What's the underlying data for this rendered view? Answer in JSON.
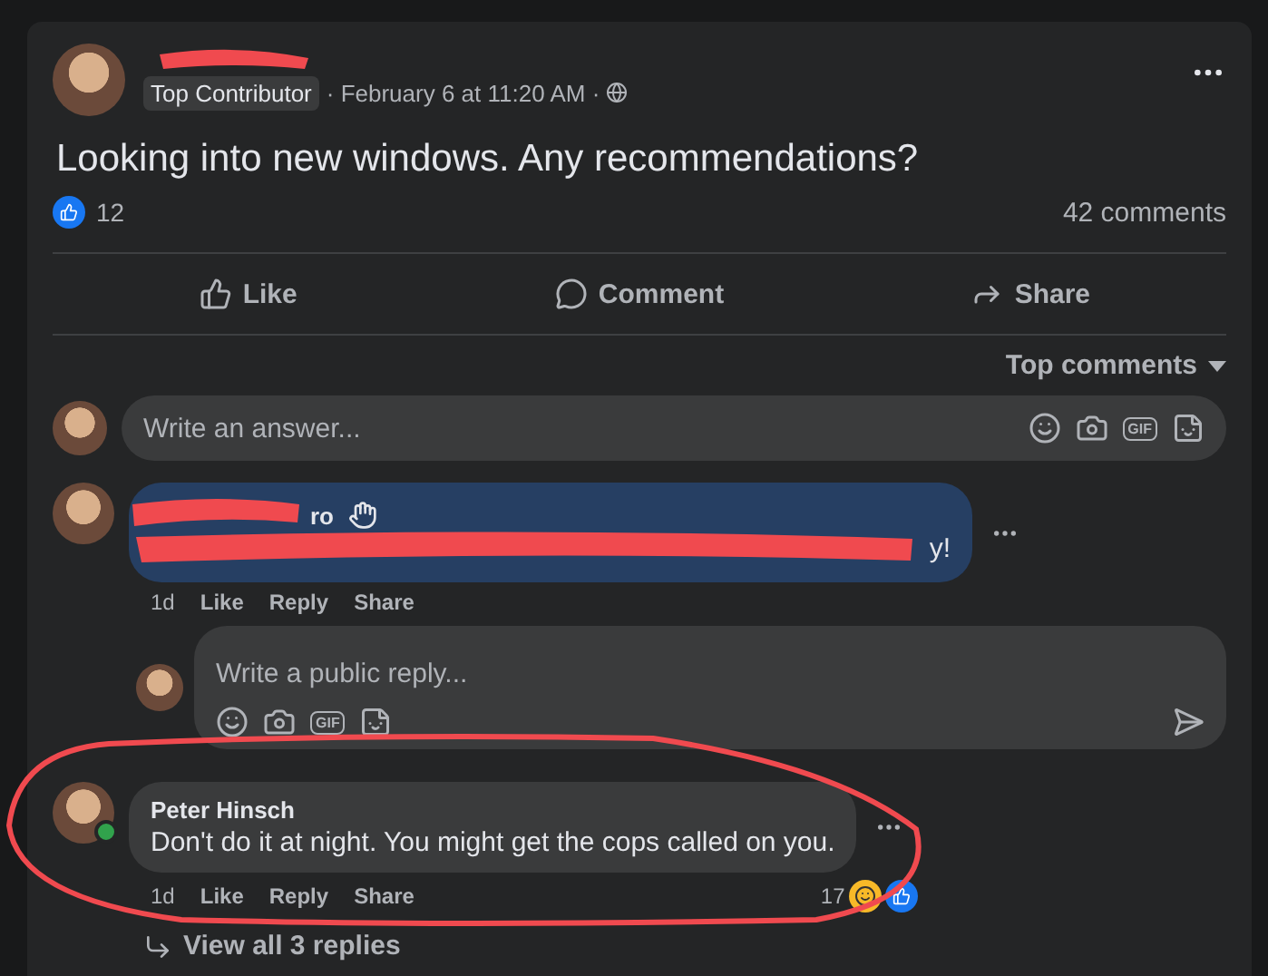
{
  "post": {
    "badge": "Top Contributor",
    "timestamp": "· February 6 at 11:20 AM ·",
    "text": "Looking into new windows. Any recommendations?",
    "likes": "12",
    "comments_count": "42 comments"
  },
  "actions": [
    "Like",
    "Comment",
    "Share"
  ],
  "sort_label": "Top comments",
  "answer_field": {
    "placeholder": "Write an answer...",
    "gif": "GIF"
  },
  "comments": [
    {
      "name": "ro",
      "text": "y!",
      "highlighted": true,
      "online": false,
      "time": "1d",
      "actions": [
        "Like",
        "Reply",
        "Share"
      ]
    },
    {
      "name": "Peter Hinsch",
      "text": "Don't do it at night. You might get the cops called on you.",
      "highlighted": false,
      "online": true,
      "time": "1d",
      "actions": [
        "Like",
        "Reply",
        "Share"
      ],
      "reaction_count": "17"
    }
  ],
  "reply_field": {
    "placeholder": "Write a public reply...",
    "gif": "GIF"
  },
  "view_replies": "View all 3 replies"
}
